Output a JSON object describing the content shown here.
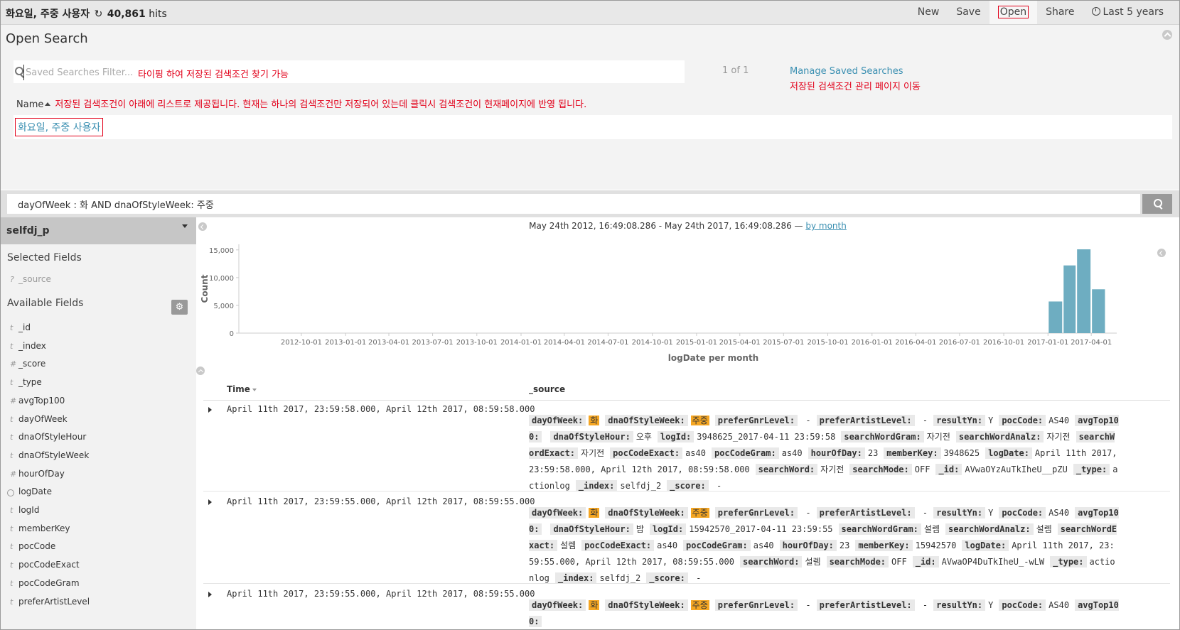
{
  "topbar": {
    "saved_title": "화요일, 주중 사용자",
    "hits_count": "40,861",
    "hits_suffix": "hits",
    "menu": {
      "new": "New",
      "save": "Save",
      "open": "Open",
      "share": "Share",
      "time": "Last 5 years"
    }
  },
  "open_search": {
    "title": "Open Search",
    "filter_placeholder": "Saved Searches Filter...",
    "filter_hint": "타이핑 하여 저장된 검색조건 찾기 가능",
    "pager": "1 of 1",
    "manage_link": "Manage Saved Searches",
    "manage_hint": "저장된 검색조건 관리 페이지 이동",
    "name_header": "Name",
    "name_hint": "저장된 검색조건이 아래에 리스트로 제공됩니다. 현재는 하나의 검색조건만 저장되어 있는데 클릭시 검색조건이 현재페이지에 반영 됩니다.",
    "saved_items": [
      "화요일, 주중 사용자"
    ]
  },
  "query": {
    "value": "dayOfWeek : 화 AND dnaOfStyleWeek: 주중"
  },
  "sidebar": {
    "index_pattern": "selfdj_p",
    "selected_title": "Selected Fields",
    "selected_fields": [
      {
        "type": "?",
        "name": "_source"
      }
    ],
    "available_title": "Available Fields",
    "fields": [
      {
        "type": "t",
        "name": "_id"
      },
      {
        "type": "t",
        "name": "_index"
      },
      {
        "type": "#",
        "name": "_score"
      },
      {
        "type": "t",
        "name": "_type"
      },
      {
        "type": "#",
        "name": "avgTop100"
      },
      {
        "type": "t",
        "name": "dayOfWeek"
      },
      {
        "type": "t",
        "name": "dnaOfStyleHour"
      },
      {
        "type": "t",
        "name": "dnaOfStyleWeek"
      },
      {
        "type": "#",
        "name": "hourOfDay"
      },
      {
        "type": "clock",
        "name": "logDate"
      },
      {
        "type": "t",
        "name": "logId"
      },
      {
        "type": "t",
        "name": "memberKey"
      },
      {
        "type": "t",
        "name": "pocCode"
      },
      {
        "type": "t",
        "name": "pocCodeExact"
      },
      {
        "type": "t",
        "name": "pocCodeGram"
      },
      {
        "type": "t",
        "name": "preferArtistLevel"
      }
    ]
  },
  "histogram": {
    "range_text": "May 24th 2012, 16:49:08.286 - May 24th 2017, 16:49:08.286 —",
    "interval_link": "by month"
  },
  "chart_data": {
    "type": "bar",
    "ylabel": "Count",
    "xlabel": "logDate per month",
    "ylim": [
      0,
      16000
    ],
    "yticks": [
      {
        "label": "0",
        "value": 0
      },
      {
        "label": "5,000",
        "value": 5000
      },
      {
        "label": "10,000",
        "value": 10000
      },
      {
        "label": "15,000",
        "value": 15000
      }
    ],
    "xticks": [
      "2012-10-01",
      "2013-01-01",
      "2013-04-01",
      "2013-07-01",
      "2013-10-01",
      "2014-01-01",
      "2014-04-01",
      "2014-07-01",
      "2014-10-01",
      "2015-01-01",
      "2015-04-01",
      "2015-07-01",
      "2015-10-01",
      "2016-01-01",
      "2016-04-01",
      "2016-07-01",
      "2016-10-01",
      "2017-01-01",
      "2017-04-01"
    ],
    "xrange": [
      "2012-05-24",
      "2017-05-24"
    ],
    "series": [
      {
        "x": [
          "2017-01-01",
          "2017-02-01",
          "2017-03-01",
          "2017-04-01"
        ],
        "values": [
          5700,
          12200,
          15100,
          7900
        ]
      }
    ],
    "bar_color": "#6eadc1"
  },
  "table": {
    "col_time": "Time",
    "col_source": "_source",
    "rows": [
      {
        "time": "April 11th 2017, 23:59:58.000, April 12th 2017, 08:59:58.000",
        "fields": [
          {
            "k": "dayOfWeek:",
            "v": "화",
            "hl": true
          },
          {
            "k": "dnaOfStyleWeek:",
            "v": "주중",
            "hl": true
          },
          {
            "k": "preferGnrLevel:",
            "v": " -"
          },
          {
            "k": "preferArtistLevel:",
            "v": " -"
          },
          {
            "k": "resultYn:",
            "v": "Y"
          },
          {
            "k": "pocCode:",
            "v": "AS40"
          },
          {
            "k": "avgTop100:",
            "v": ""
          },
          {
            "k": "dnaOfStyleHour:",
            "v": "오후"
          },
          {
            "k": "logId:",
            "v": "3948625_2017-04-11 23:59:58"
          },
          {
            "k": "searchWordGram:",
            "v": "자기전"
          },
          {
            "k": "searchWordAnalz:",
            "v": "자기전"
          },
          {
            "k": "searchWordExact:",
            "v": "자기전"
          },
          {
            "k": "pocCodeExact:",
            "v": "as40"
          },
          {
            "k": "pocCodeGram:",
            "v": "as40"
          },
          {
            "k": "hourOfDay:",
            "v": "23"
          },
          {
            "k": "memberKey:",
            "v": "3948625"
          },
          {
            "k": "logDate:",
            "v": "April 11th 2017, 23:59:58.000, April 12th 2017, 08:59:58.000"
          },
          {
            "k": "searchWord:",
            "v": "자기전"
          },
          {
            "k": "searchMode:",
            "v": "OFF"
          },
          {
            "k": "_id:",
            "v": "AVwaOYzAuTkIheU__pZU"
          },
          {
            "k": "_type:",
            "v": "actionlog"
          },
          {
            "k": "_index:",
            "v": "selfdj_2"
          },
          {
            "k": "_score:",
            "v": " -"
          }
        ]
      },
      {
        "time": "April 11th 2017, 23:59:55.000, April 12th 2017, 08:59:55.000",
        "fields": [
          {
            "k": "dayOfWeek:",
            "v": "화",
            "hl": true
          },
          {
            "k": "dnaOfStyleWeek:",
            "v": "주중",
            "hl": true
          },
          {
            "k": "preferGnrLevel:",
            "v": " -"
          },
          {
            "k": "preferArtistLevel:",
            "v": " -"
          },
          {
            "k": "resultYn:",
            "v": "Y"
          },
          {
            "k": "pocCode:",
            "v": "AS40"
          },
          {
            "k": "avgTop100:",
            "v": ""
          },
          {
            "k": "dnaOfStyleHour:",
            "v": "밤"
          },
          {
            "k": "logId:",
            "v": "15942570_2017-04-11 23:59:55"
          },
          {
            "k": "searchWordGram:",
            "v": "설렘"
          },
          {
            "k": "searchWordAnalz:",
            "v": "설렘"
          },
          {
            "k": "searchWordExact:",
            "v": "설렘"
          },
          {
            "k": "pocCodeExact:",
            "v": "as40"
          },
          {
            "k": "pocCodeGram:",
            "v": "as40"
          },
          {
            "k": "hourOfDay:",
            "v": "23"
          },
          {
            "k": "memberKey:",
            "v": "15942570"
          },
          {
            "k": "logDate:",
            "v": "April 11th 2017, 23:59:55.000, April 12th 2017, 08:59:55.000"
          },
          {
            "k": "searchWord:",
            "v": "설렘"
          },
          {
            "k": "searchMode:",
            "v": "OFF"
          },
          {
            "k": "_id:",
            "v": "AVwaOP4DuTkIheU_-wLW"
          },
          {
            "k": "_type:",
            "v": "actionlog"
          },
          {
            "k": "_index:",
            "v": "selfdj_2"
          },
          {
            "k": "_score:",
            "v": " -"
          }
        ]
      },
      {
        "time": "April 11th 2017, 23:59:55.000, April 12th 2017, 08:59:55.000",
        "fields": [
          {
            "k": "dayOfWeek:",
            "v": "화",
            "hl": true
          },
          {
            "k": "dnaOfStyleWeek:",
            "v": "주중",
            "hl": true
          },
          {
            "k": "preferGnrLevel:",
            "v": " -"
          },
          {
            "k": "preferArtistLevel:",
            "v": " -"
          },
          {
            "k": "resultYn:",
            "v": "Y"
          },
          {
            "k": "pocCode:",
            "v": "AS40"
          },
          {
            "k": "avgTop100:",
            "v": ""
          }
        ]
      }
    ]
  }
}
